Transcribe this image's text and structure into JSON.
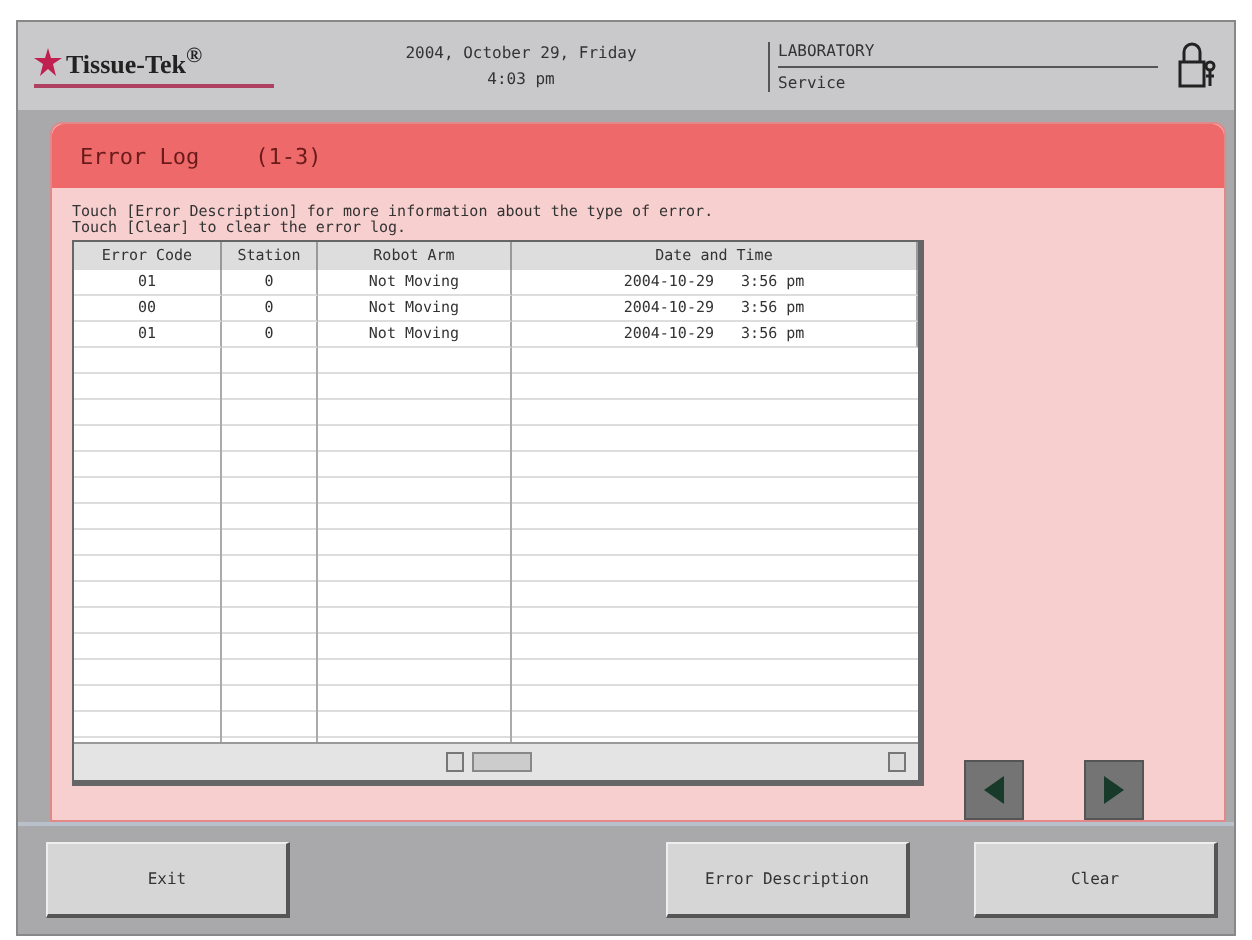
{
  "header": {
    "logo": "Tissue-Tek$^{®}$",
    "date": "2004, October 29, Friday",
    "time": "4:03 pm",
    "mode": "LABORATORY",
    "user": "Service"
  },
  "panel": {
    "title": "Error Log",
    "range": "(1-3)",
    "instructions": [
      "Touch [Error Description] for more information about the type of error.",
      "Touch [Clear] to clear the error log."
    ]
  },
  "table": {
    "columns": [
      "Error Code",
      "Station",
      "Robot Arm",
      "Date and Time"
    ],
    "rows": [
      {
        "error_code": "01",
        "station": "0",
        "robot_arm": "Not Moving",
        "date_time": "2004-10-29   3:56 pm"
      },
      {
        "error_code": "00",
        "station": "0",
        "robot_arm": "Not Moving",
        "date_time": "2004-10-29   3:56 pm"
      },
      {
        "error_code": "01",
        "station": "0",
        "robot_arm": "Not Moving",
        "date_time": "2004-10-29   3:56 pm"
      }
    ]
  },
  "buttons": [
    "Exit",
    "Error Description",
    "Clear"
  ]
}
